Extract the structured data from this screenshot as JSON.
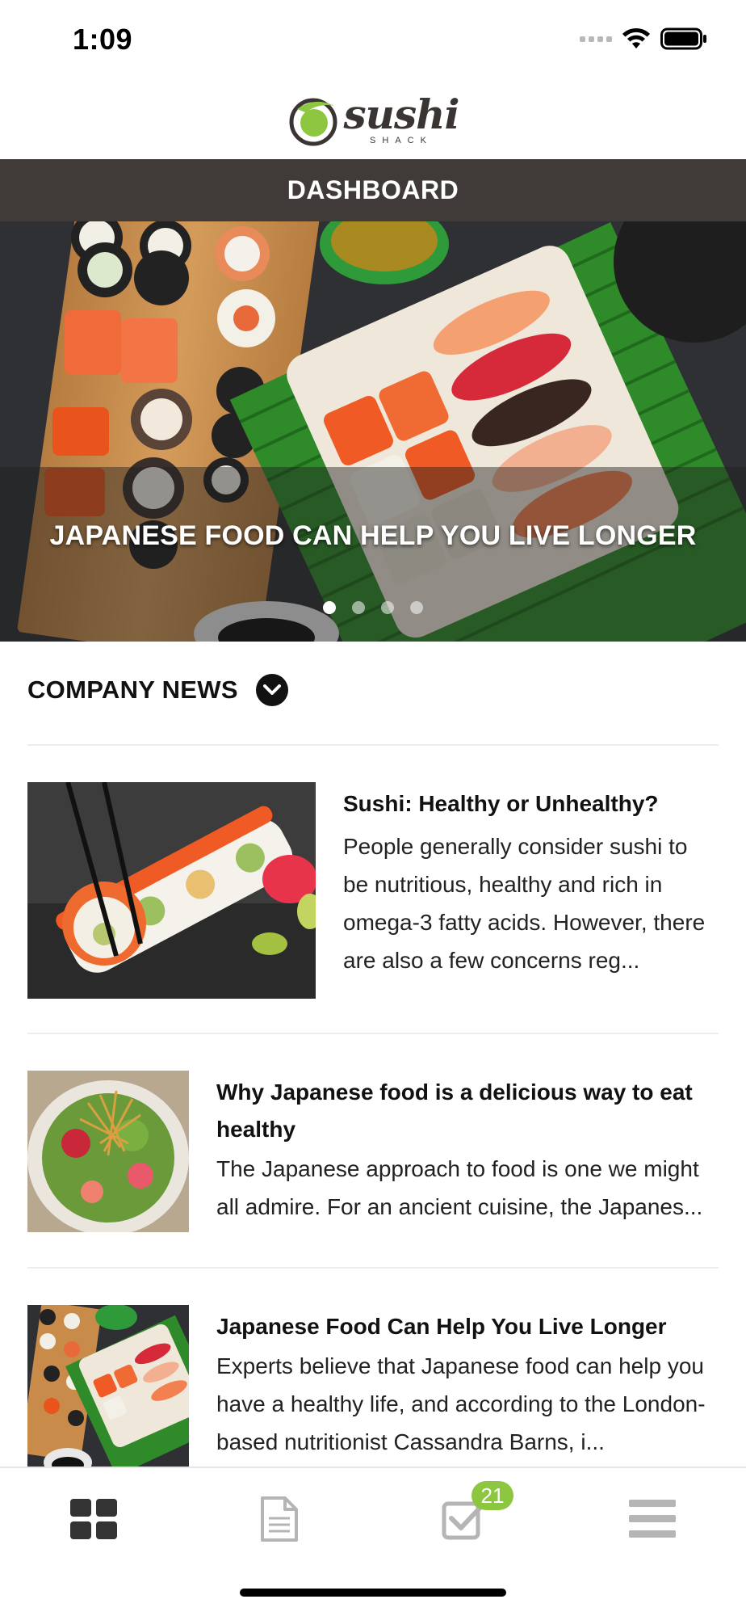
{
  "status": {
    "time": "1:09"
  },
  "brand": {
    "word": "sushi",
    "sub": "SHACK",
    "accent_color": "#8dc63f"
  },
  "header": {
    "title": "DASHBOARD",
    "bar_color": "#403a38"
  },
  "hero": {
    "caption": "JAPANESE FOOD CAN HELP YOU LIVE LONGER",
    "slide_count": 4,
    "active_slide": 1
  },
  "news": {
    "heading": "COMPANY NEWS",
    "items": [
      {
        "title": "Sushi: Healthy or Unhealthy?",
        "text": "People generally consider sushi to be nutritious, healthy and rich in omega-3 fatty acids. However, there are also a few concerns reg..."
      },
      {
        "title": "Why Japanese food is a delicious way to eat healthy",
        "text": "The Japanese approach to food is one we might all admire. For an ancient cuisine, the Japanes..."
      },
      {
        "title": "Japanese Food Can Help You Live Longer",
        "text": "Experts believe that Japanese food can help you have a healthy life, and according to the London-based nutritionist Cassandra Barns, i..."
      }
    ]
  },
  "tabs": [
    {
      "name": "dashboard",
      "icon": "grid-icon",
      "active": true
    },
    {
      "name": "documents",
      "icon": "document-icon",
      "active": false
    },
    {
      "name": "tasks",
      "icon": "checkbox-icon",
      "active": false,
      "badge": "21"
    },
    {
      "name": "menu",
      "icon": "hamburger-icon",
      "active": false
    }
  ]
}
